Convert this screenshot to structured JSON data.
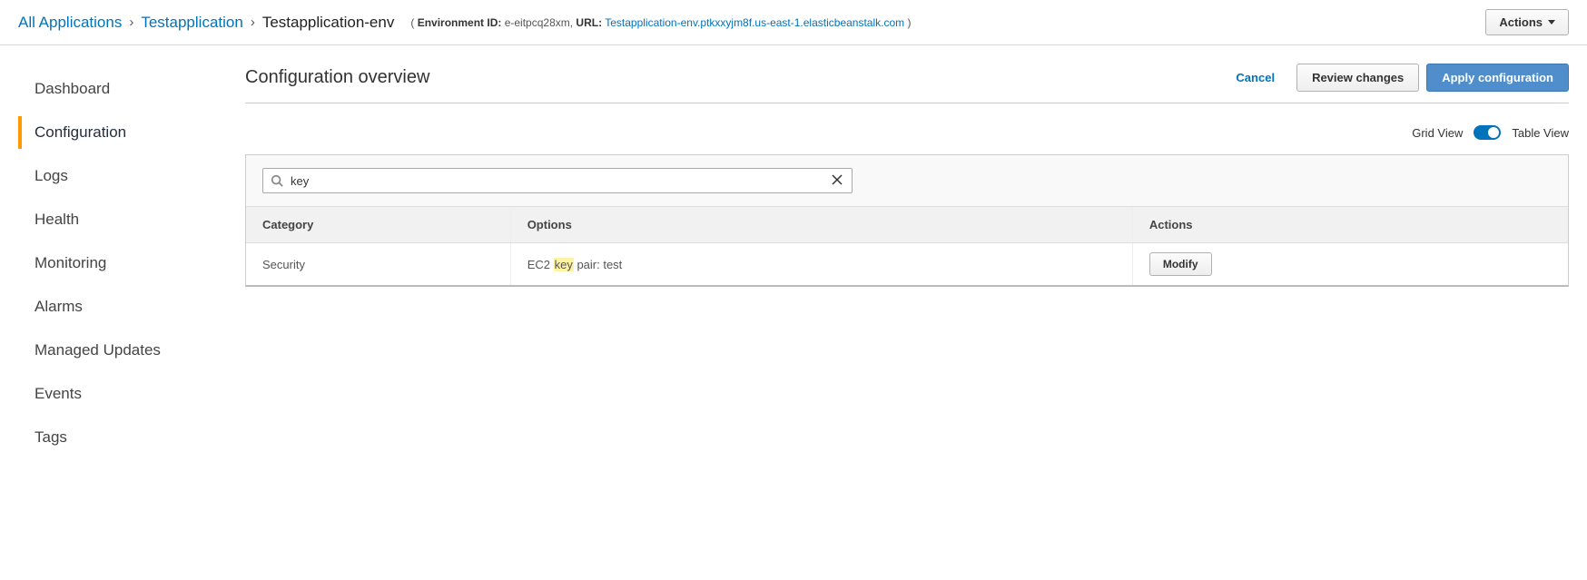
{
  "breadcrumb": {
    "all_apps": "All Applications",
    "app": "Testapplication",
    "env": "Testapplication-env",
    "env_id_label": "Environment ID:",
    "env_id_value": "e-eitpcq28xm",
    "url_label": "URL:",
    "url_value": "Testapplication-env.ptkxxyjm8f.us-east-1.elasticbeanstalk.com"
  },
  "actions_button": "Actions",
  "sidebar": {
    "items": [
      {
        "label": "Dashboard"
      },
      {
        "label": "Configuration"
      },
      {
        "label": "Logs"
      },
      {
        "label": "Health"
      },
      {
        "label": "Monitoring"
      },
      {
        "label": "Alarms"
      },
      {
        "label": "Managed Updates"
      },
      {
        "label": "Events"
      },
      {
        "label": "Tags"
      }
    ],
    "active_index": 1
  },
  "page": {
    "title": "Configuration overview",
    "cancel": "Cancel",
    "review": "Review changes",
    "apply": "Apply configuration"
  },
  "view_toggle": {
    "grid": "Grid View",
    "table": "Table View",
    "state": "table"
  },
  "search": {
    "value": "key"
  },
  "table": {
    "headers": {
      "category": "Category",
      "options": "Options",
      "actions": "Actions"
    },
    "rows": [
      {
        "category": "Security",
        "option_prefix": "EC2 ",
        "option_highlight": "key",
        "option_suffix": " pair: test",
        "modify": "Modify"
      }
    ]
  }
}
